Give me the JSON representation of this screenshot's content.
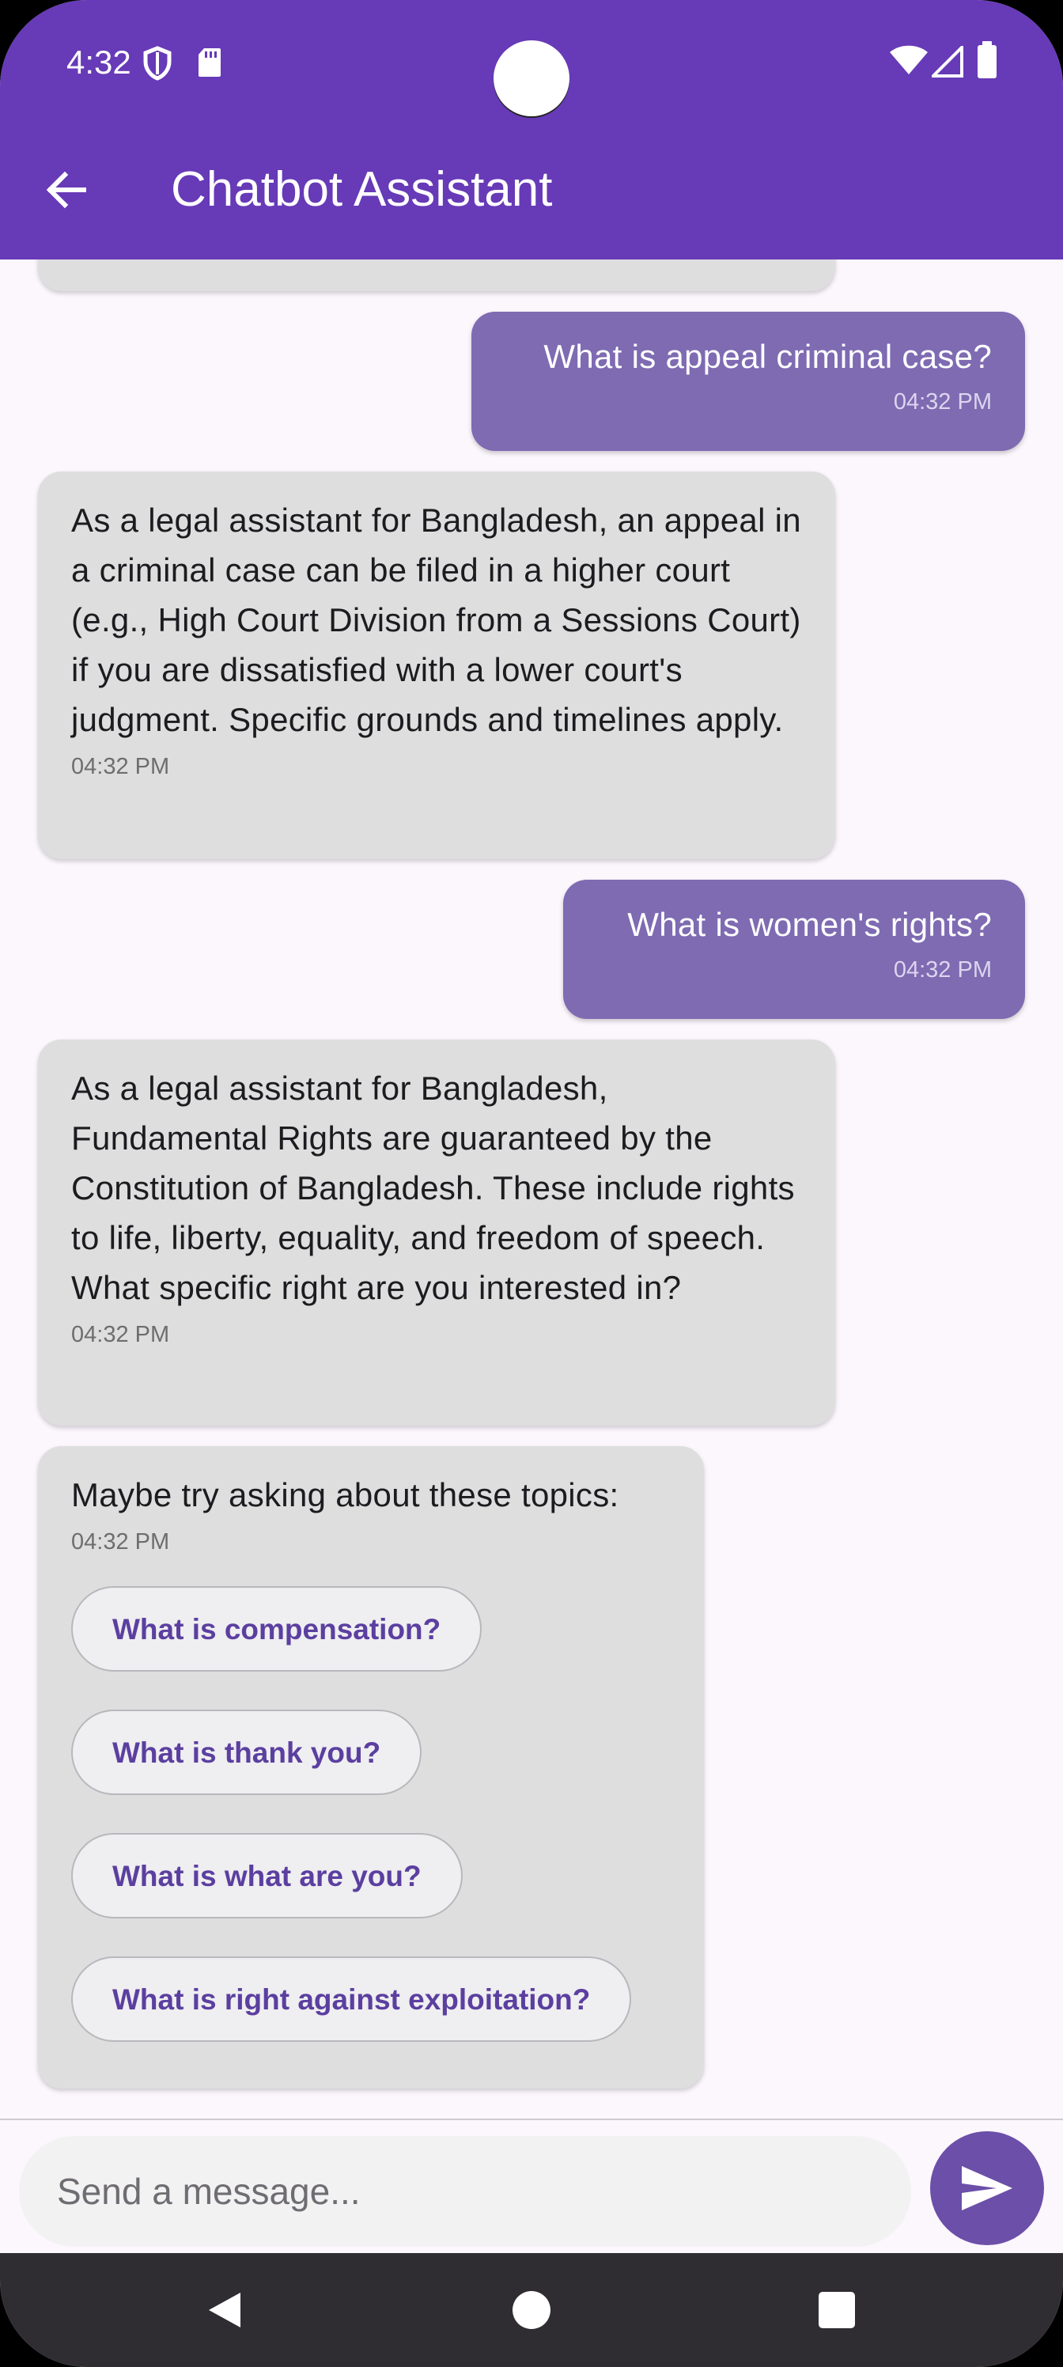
{
  "status_bar": {
    "time": "4:32",
    "left_icons": [
      "shield-icon",
      "sd-card-icon"
    ],
    "right_icons": [
      "wifi-icon",
      "signal-icon",
      "battery-icon"
    ]
  },
  "app_bar": {
    "title": "Chatbot Assistant",
    "back_icon": "arrow-back-icon",
    "color": "#673ab7"
  },
  "messages": [
    {
      "sender": "user",
      "text": "What is appeal criminal case?",
      "time": "04:32 PM"
    },
    {
      "sender": "bot",
      "text": "As a legal assistant for Bangladesh, an appeal in a criminal case can be filed in a higher court (e.g., High Court Division from a Sessions Court) if you are dissatisfied with a lower court's judgment. Specific grounds and timelines apply.",
      "time": "04:32 PM"
    },
    {
      "sender": "user",
      "text": "What is women's rights?",
      "time": "04:32 PM"
    },
    {
      "sender": "bot",
      "text": "As a legal assistant for Bangladesh, Fundamental Rights are guaranteed by the Constitution of Bangladesh. These include rights to life, liberty, equality, and freedom of speech. What specific right are you interested in?",
      "time": "04:32 PM"
    },
    {
      "sender": "bot",
      "text": "Maybe try asking about these topics:",
      "time": "04:32 PM",
      "suggestions": [
        "What is compensation?",
        "What is thank you?",
        "What is what are you?",
        "What is right against exploitation?"
      ]
    }
  ],
  "input": {
    "placeholder": "Send a message...",
    "value": ""
  },
  "send_icon": "send-icon",
  "nav_bar": {
    "icons": [
      "nav-back-icon",
      "nav-home-icon",
      "nav-recents-icon"
    ]
  },
  "colors": {
    "user_bubble": "#7e6bb2",
    "bot_bubble": "#dedede",
    "chip_text": "#5b3fa0",
    "send_button": "#6b4fa8"
  }
}
